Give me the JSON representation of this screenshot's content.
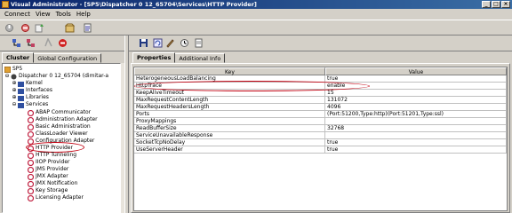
{
  "window": {
    "title": "Visual Administrator - [SP5\\Dispatcher 0 12_65704\\Services\\HTTP Provider]"
  },
  "menu": {
    "items": [
      "Connect",
      "View",
      "Tools",
      "Help"
    ]
  },
  "left_tabs": [
    "Cluster",
    "Global Configuration"
  ],
  "tree": {
    "nodes": [
      {
        "label": "SP5",
        "icon": "cluster-icon"
      },
      {
        "label": "Dispatcher 0 12_65704 (dimitar-a",
        "icon": "dispatcher-icon"
      },
      {
        "label": "Kernel",
        "icon": "folder-icon"
      },
      {
        "label": "Interfaces",
        "icon": "folder-icon"
      },
      {
        "label": "Libraries",
        "icon": "folder-icon"
      },
      {
        "label": "Services",
        "icon": "folder-icon"
      },
      {
        "label": "ABAP Communicator",
        "icon": "service-icon"
      },
      {
        "label": "Administration Adapter",
        "icon": "service-icon"
      },
      {
        "label": "Basic Administration",
        "icon": "service-icon"
      },
      {
        "label": "ClassLoader Viewer",
        "icon": "service-icon"
      },
      {
        "label": "Configuration Adapter",
        "icon": "service-icon"
      },
      {
        "label": "HTTP Provider",
        "icon": "service-icon"
      },
      {
        "label": "HTTP Tunneling",
        "icon": "service-icon"
      },
      {
        "label": "IIOP Provider",
        "icon": "service-icon"
      },
      {
        "label": "JMS Provider",
        "icon": "service-icon"
      },
      {
        "label": "JMX Adapter",
        "icon": "service-icon"
      },
      {
        "label": "JMX Notification",
        "icon": "service-icon"
      },
      {
        "label": "Key Storage",
        "icon": "service-icon"
      },
      {
        "label": "Licensing Adapter",
        "icon": "service-icon"
      }
    ]
  },
  "right_tabs": [
    "Properties",
    "Additional Info"
  ],
  "table": {
    "columns": [
      "Key",
      "Value"
    ],
    "rows": [
      {
        "key": "HeterogeneousLoadBalancing",
        "value": "true"
      },
      {
        "key": "HttpTrace",
        "value": "enable"
      },
      {
        "key": "KeepAliveTimeout",
        "value": "15"
      },
      {
        "key": "MaxRequestContentLength",
        "value": "131072"
      },
      {
        "key": "MaxRequestHeadersLength",
        "value": "4096"
      },
      {
        "key": "Ports",
        "value": "(Port:51200,Type:http)(Port:51201,Type:ssl)"
      },
      {
        "key": "ProxyMappings",
        "value": ""
      },
      {
        "key": "ReadBufferSize",
        "value": "32768"
      },
      {
        "key": "ServiceUnavailableResponse",
        "value": ""
      },
      {
        "key": "SocketTcpNoDelay",
        "value": "true"
      },
      {
        "key": "UseServerHeader",
        "value": "true"
      }
    ]
  },
  "colors": {
    "titlebar": "#0a246a",
    "highlight": "#c00010",
    "face": "#d4d0c8"
  }
}
